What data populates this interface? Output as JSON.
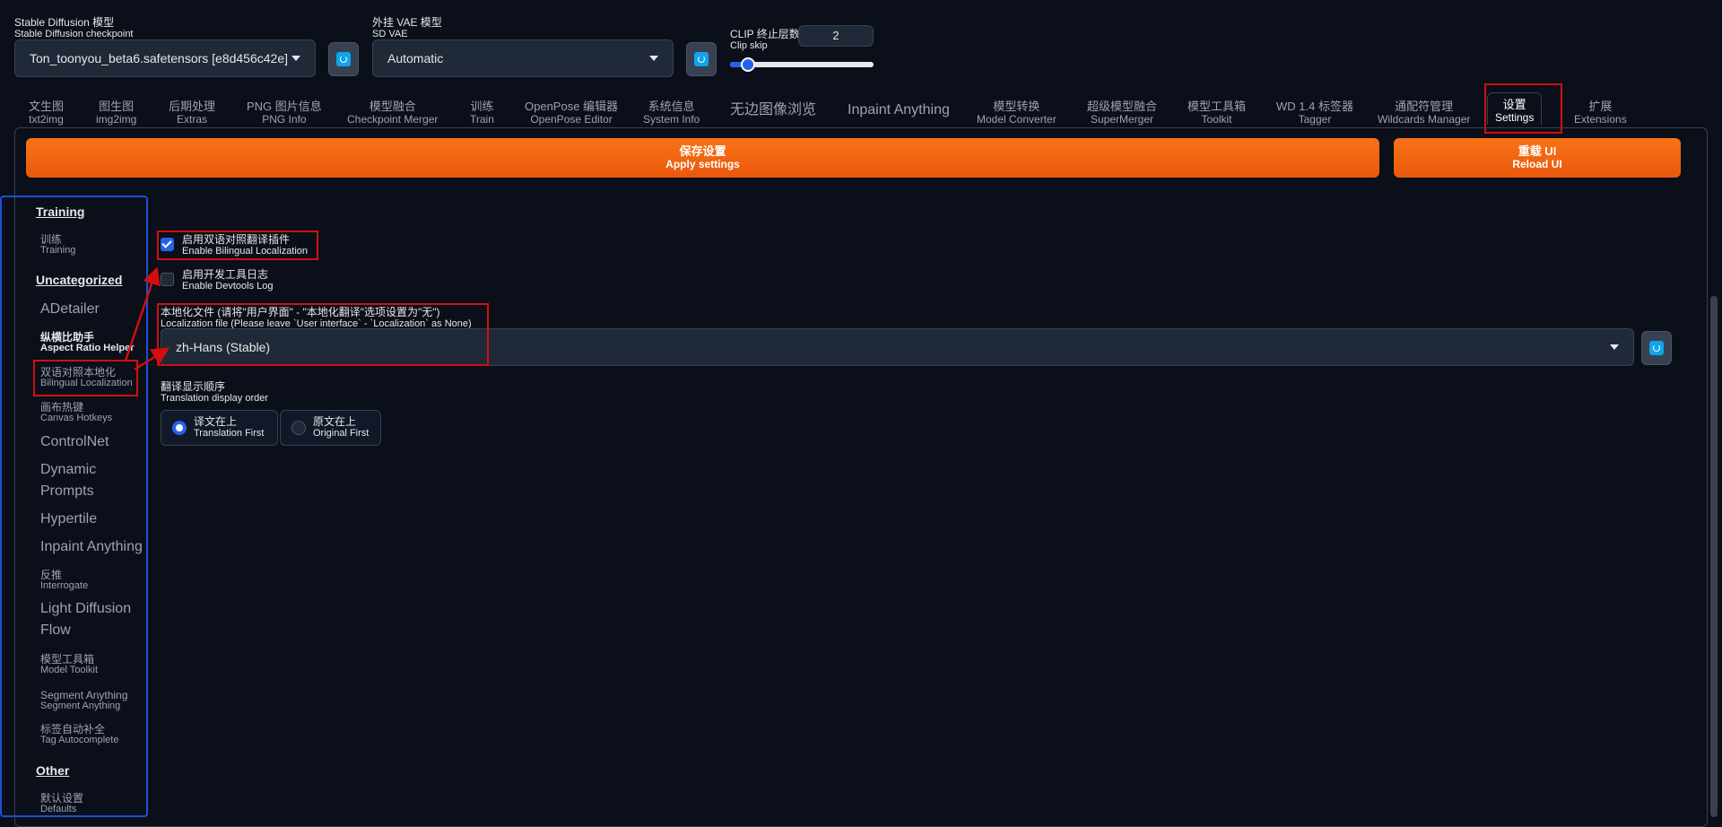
{
  "checkpoint": {
    "label_zh": "Stable Diffusion 模型",
    "label_en": "Stable Diffusion checkpoint",
    "value": "Ton_toonyou_beta6.safetensors [e8d456c42e]"
  },
  "vae": {
    "label_zh": "外挂 VAE 模型",
    "label_en": "SD VAE",
    "value": "Automatic"
  },
  "clip": {
    "label_zh": "CLIP 终止层数",
    "label_en": "Clip skip",
    "value": "2",
    "slider_fraction": 0.1
  },
  "tabs": [
    {
      "zh": "文生图",
      "en": "txt2img"
    },
    {
      "zh": "图生图",
      "en": "img2img"
    },
    {
      "zh": "后期处理",
      "en": "Extras"
    },
    {
      "zh": "PNG 图片信息",
      "en": "PNG Info"
    },
    {
      "zh": "模型融合",
      "en": "Checkpoint Merger"
    },
    {
      "zh": "训练",
      "en": "Train"
    },
    {
      "zh": "OpenPose 编辑器",
      "en": "OpenPose Editor"
    },
    {
      "zh": "系统信息",
      "en": "System Info"
    },
    {
      "zh": "无边图像浏览",
      "en": ""
    },
    {
      "zh": "Inpaint Anything",
      "en": ""
    },
    {
      "zh": "模型转换",
      "en": "Model Converter"
    },
    {
      "zh": "超级模型融合",
      "en": "SuperMerger"
    },
    {
      "zh": "模型工具箱",
      "en": "Toolkit"
    },
    {
      "zh": "WD 1.4 标签器",
      "en": "Tagger"
    },
    {
      "zh": "通配符管理",
      "en": "Wildcards Manager"
    },
    {
      "zh": "设置",
      "en": "Settings"
    },
    {
      "zh": "扩展",
      "en": "Extensions"
    }
  ],
  "buttons": {
    "apply_zh": "保存设置",
    "apply_en": "Apply settings",
    "reload_zh": "重载 UI",
    "reload_en": "Reload UI"
  },
  "sidebar": {
    "training_head": "Training",
    "training": {
      "zh": "训练",
      "en": "Training"
    },
    "uncat_head": "Uncategorized",
    "adetailer": "ADetailer",
    "aspect": {
      "zh": "纵横比助手",
      "en": "Aspect Ratio Helper"
    },
    "bilingual": {
      "zh": "双语对照本地化",
      "en": "Bilingual Localization"
    },
    "canvas": {
      "zh": "画布热键",
      "en": "Canvas Hotkeys"
    },
    "controlnet": "ControlNet",
    "dynamic1": "Dynamic",
    "dynamic2": "Prompts",
    "hypertile": "Hypertile",
    "inpaint": "Inpaint Anything",
    "interrogate": {
      "zh": "反推",
      "en": "Interrogate"
    },
    "ldf1": "Light Diffusion",
    "ldf2": "Flow",
    "toolkit": {
      "zh": "模型工具箱",
      "en": "Model Toolkit"
    },
    "segment": {
      "zh": "Segment Anything",
      "en": "Segment Anything"
    },
    "tag": {
      "zh": "标签自动补全",
      "en": "Tag Autocomplete"
    },
    "other_head": "Other",
    "defaults": {
      "zh": "默认设置",
      "en": "Defaults"
    }
  },
  "settings": {
    "enable_zh": "启用双语对照翻译插件",
    "enable_en": "Enable Bilingual Localization",
    "enable_checked": true,
    "devtools_zh": "启用开发工具日志",
    "devtools_en": "Enable Devtools Log",
    "devtools_checked": false,
    "locfile_zh": "本地化文件 (请将\"用户界面\" - \"本地化翻译\"选项设置为\"无\")",
    "locfile_en": "Localization file (Please leave `User interface` - `Localization` as None)",
    "locfile_value": "zh-Hans (Stable)",
    "order_zh": "翻译显示顺序",
    "order_en": "Translation display order",
    "opt1_zh": "译文在上",
    "opt1_en": "Translation First",
    "opt2_zh": "原文在上",
    "opt2_en": "Original First"
  },
  "colors": {
    "background": "#0b0f19",
    "accent_orange": "#f97316",
    "annotation_red": "#d10f0f",
    "sidebar_blue": "#1d4ed8"
  }
}
